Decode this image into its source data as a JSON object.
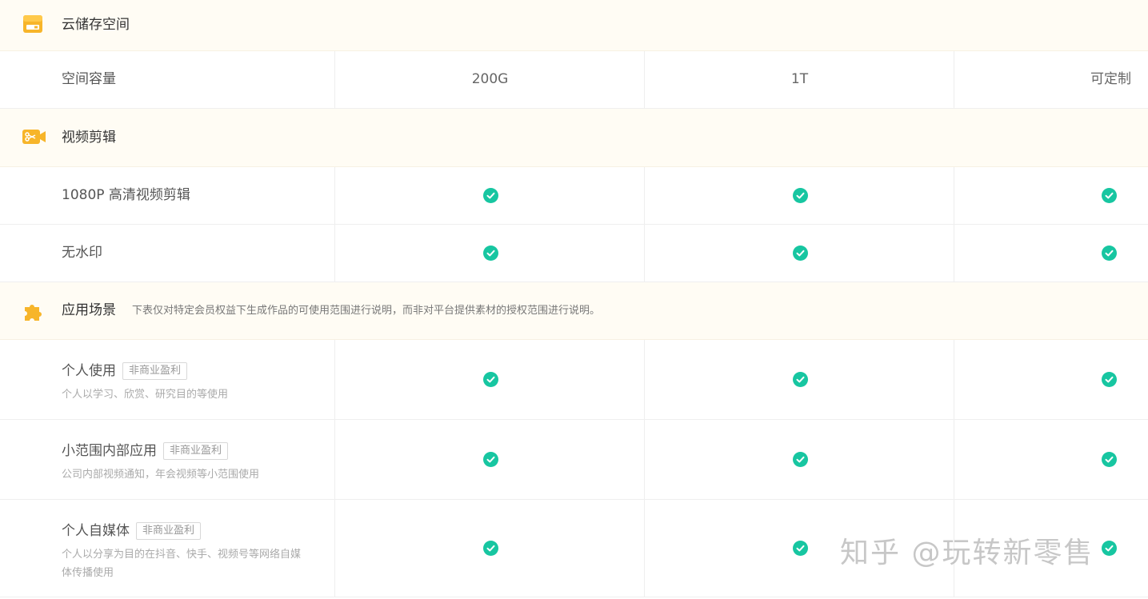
{
  "colors": {
    "section_bg": "#fffcf4",
    "check": "#17c6a1",
    "icon_orange": "#f7b52a"
  },
  "sections": {
    "storage": {
      "icon": "storage-box-icon",
      "title": "云储存空间",
      "rows": {
        "capacity": {
          "label": "空间容量",
          "values": [
            "200G",
            "1T",
            "可定制"
          ]
        }
      }
    },
    "video": {
      "icon": "scissors-camera-icon",
      "title": "视频剪辑",
      "rows": {
        "hd": {
          "label": "1080P 高清视频剪辑",
          "values": [
            "check",
            "check",
            "check"
          ]
        },
        "nowatermark": {
          "label": "无水印",
          "values": [
            "check",
            "check",
            "check"
          ]
        }
      }
    },
    "usage": {
      "icon": "puzzle-piece-icon",
      "title": "应用场景",
      "note": "下表仅对特定会员权益下生成作品的可使用范围进行说明，而非对平台提供素材的授权范围进行说明。",
      "rows": {
        "personal": {
          "label": "个人使用",
          "badge": "非商业盈利",
          "desc": "个人以学习、欣赏、研究目的等使用",
          "values": [
            "check",
            "check",
            "check"
          ]
        },
        "internal": {
          "label": "小范围内部应用",
          "badge": "非商业盈利",
          "desc": "公司内部视频通知，年会视频等小范围使用",
          "values": [
            "check",
            "check",
            "check"
          ]
        },
        "selfmedia": {
          "label": "个人自媒体",
          "badge": "非商业盈利",
          "desc": "个人以分享为目的在抖音、快手、视频号等网络自媒体传播使用",
          "values": [
            "check",
            "check",
            "check"
          ]
        }
      }
    }
  },
  "watermark": "知乎 @玩转新零售"
}
